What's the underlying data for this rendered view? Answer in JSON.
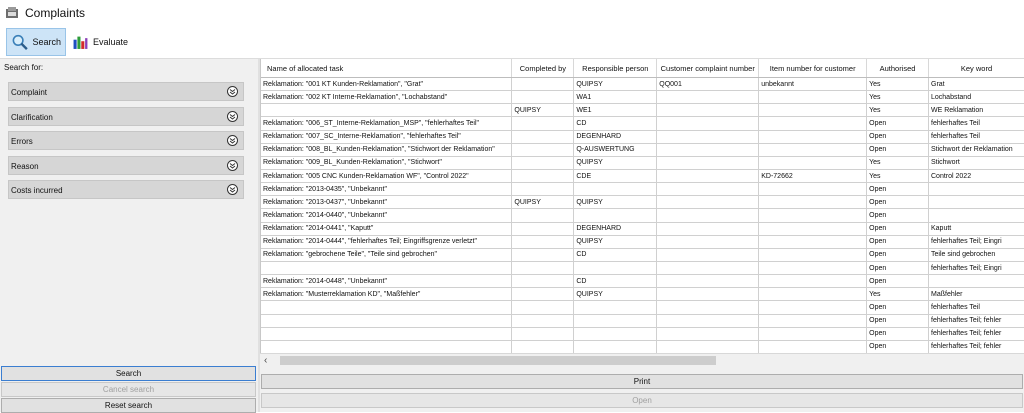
{
  "window": {
    "title": "Complaints"
  },
  "toolbar": {
    "search_label": "Search",
    "evaluate_label": "Evaluate"
  },
  "left": {
    "search_for": "Search for:",
    "criteria": [
      "Complaint",
      "Clarification",
      "Errors",
      "Reason",
      "Costs incurred"
    ],
    "search_btn": "Search",
    "cancel_btn": "Cancel search",
    "reset_btn": "Reset search"
  },
  "table": {
    "columns": [
      "Name of allocated task",
      "Completed by",
      "Responsible person",
      "Customer complaint number",
      "Item number for customer",
      "Authorised",
      "Key word"
    ],
    "rows": [
      [
        "Reklamation: \"001 KT Kunden-Reklamation\", \"Grat\"",
        "",
        "QUIPSY",
        "QQ001",
        "unbekannt",
        "Yes",
        "Grat"
      ],
      [
        "Reklamation: \"002 KT Interne-Reklamation\", \"Lochabstand\"",
        "",
        "WA1",
        "",
        "",
        "Yes",
        "Lochabstand"
      ],
      [
        "",
        "QUIPSY",
        "WE1",
        "",
        "",
        "Yes",
        "WE Reklamation"
      ],
      [
        "Reklamation: \"006_ST_Interne-Reklamation_MSP\", \"fehlerhaftes Teil\"",
        "",
        "CD",
        "",
        "",
        "Open",
        "fehlerhaftes Teil"
      ],
      [
        "Reklamation: \"007_SC_Interne-Reklamation\", \"fehlerhaftes Teil\"",
        "",
        "DEGENHARD",
        "",
        "",
        "Open",
        "fehlerhaftes Teil"
      ],
      [
        "Reklamation: \"008_BL_Kunden-Reklamation\", \"Stichwort der Reklamation\"",
        "",
        "Q-AUSWERTUNG",
        "",
        "",
        "Open",
        "Stichwort der Reklamation"
      ],
      [
        "Reklamation: \"009_BL_Kunden-Reklamation\", \"Stichwort\"",
        "",
        "QUIPSY",
        "",
        "",
        "Yes",
        "Stichwort"
      ],
      [
        "Reklamation: \"005 CNC Kunden-Reklamation WF\", \"Control 2022\"",
        "",
        "CDE",
        "",
        "KD-72662",
        "Yes",
        "Control 2022"
      ],
      [
        "Reklamation: \"2013-0435\", \"Unbekannt\"",
        "",
        "",
        "",
        "",
        "Open",
        ""
      ],
      [
        "Reklamation: \"2013-0437\", \"Unbekannt\"",
        "QUIPSY",
        "QUIPSY",
        "",
        "",
        "Open",
        ""
      ],
      [
        "Reklamation: \"2014-0440\", \"Unbekannt\"",
        "",
        "",
        "",
        "",
        "Open",
        ""
      ],
      [
        "Reklamation: \"2014-0441\", \"Kaputt\"",
        "",
        "DEGENHARD",
        "",
        "",
        "Open",
        "Kaputt"
      ],
      [
        "Reklamation: \"2014-0444\", \"fehlerhaftes Teil; Eingriffsgrenze verletzt\"",
        "",
        "QUIPSY",
        "",
        "",
        "Open",
        "fehlerhaftes Teil; Eingri"
      ],
      [
        "Reklamation: \"gebrochene Teile\", \"Teile sind gebrochen\"",
        "",
        "CD",
        "",
        "",
        "Open",
        "Teile sind gebrochen"
      ],
      [
        "",
        "",
        "",
        "",
        "",
        "Open",
        "fehlerhaftes Teil; Eingri"
      ],
      [
        "Reklamation: \"2014-0448\", \"Unbekannt\"",
        "",
        "CD",
        "",
        "",
        "Open",
        ""
      ],
      [
        "Reklamation: \"Musterreklamation KD\", \"Maßfehler\"",
        "",
        "QUIPSY",
        "",
        "",
        "Yes",
        "Maßfehler"
      ],
      [
        "",
        "",
        "",
        "",
        "",
        "Open",
        "fehlerhaftes Teil"
      ],
      [
        "",
        "",
        "",
        "",
        "",
        "Open",
        "fehlerhaftes Teil; fehler"
      ],
      [
        "",
        "",
        "",
        "",
        "",
        "Open",
        "fehlerhaftes Teil; fehler"
      ],
      [
        "",
        "",
        "",
        "",
        "",
        "Open",
        "fehlerhaftes Teil; fehler"
      ]
    ]
  },
  "bottom": {
    "print_btn": "Print",
    "open_btn": "Open"
  }
}
